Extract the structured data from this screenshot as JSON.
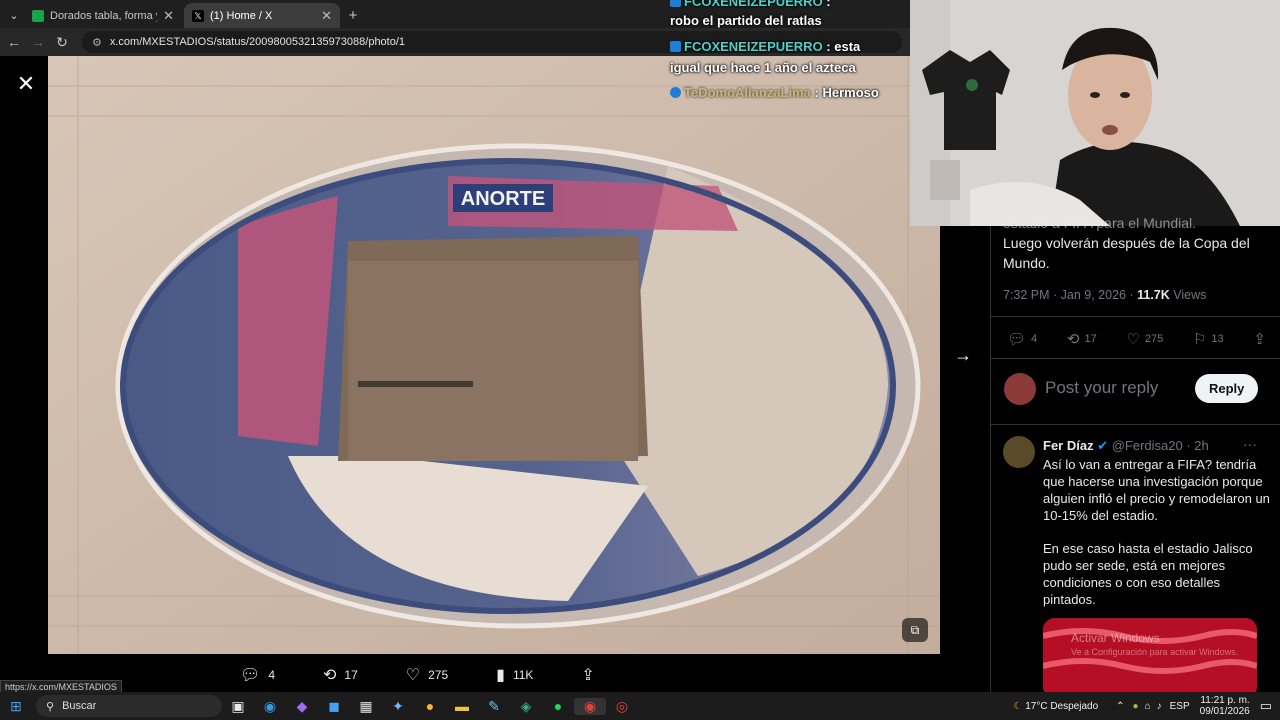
{
  "browser": {
    "tabs": [
      {
        "label": "Dorados tabla, forma y próximos"
      },
      {
        "label": "(1) Home / X"
      }
    ],
    "url": "x.com/MXESTADIOS/status/2009800532135973088/photo/1",
    "status_url": "https://x.com/MXESTADIOS"
  },
  "photo": {
    "sign_text": "ANORTE"
  },
  "chat": [
    {
      "user": "FCOXENEIZEPUERRO",
      "text": "robo el partido del ratlas"
    },
    {
      "user": "FCOXENEIZEPUERRO",
      "text": "esta",
      "cont": "igual que hace 1 año el azteca"
    },
    {
      "user": "TeDomoAlianzaLima",
      "text": "Hermoso"
    }
  ],
  "photo_stats": {
    "replies": "4",
    "reposts": "17",
    "likes": "275",
    "views": "11K"
  },
  "tweet": {
    "text_partial": "estadio a FIFA para el Mundial.",
    "text": "Luego volverán después de la Copa del Mundo.",
    "time": "7:32 PM · Jan 9, 2026 · ",
    "views_count": "11.7K",
    "views_label": " Views",
    "replies": "4",
    "reposts": "17",
    "likes": "275",
    "bookmarks": "13"
  },
  "reply_box": {
    "placeholder": "Post your reply",
    "button": "Reply"
  },
  "reply": {
    "name": "Fer Díaz",
    "handle": "@Ferdisa20 · 2h",
    "p1": "Así lo van a entregar a FIFA? tendría que hacerse una investigación porque alguien infló el precio y remodelaron un 10-15% del estadio.",
    "p2": "En ese caso hasta el estadio Jalisco pudo ser sede, está en mejores condiciones o con eso detalles pintados.",
    "watermark1": "Activar Windows",
    "watermark2": "Ve a Configuración para activar Windows."
  },
  "taskbar": {
    "search": "Buscar",
    "weather": "17°C",
    "weather_desc": "Despejado",
    "lang": "ESP",
    "time": "11:21 p. m.",
    "date": "09/01/2026"
  },
  "colors": {
    "accent": "#1d9bf0",
    "x_bg": "#000000",
    "chat_user": "#4cd1c9"
  }
}
